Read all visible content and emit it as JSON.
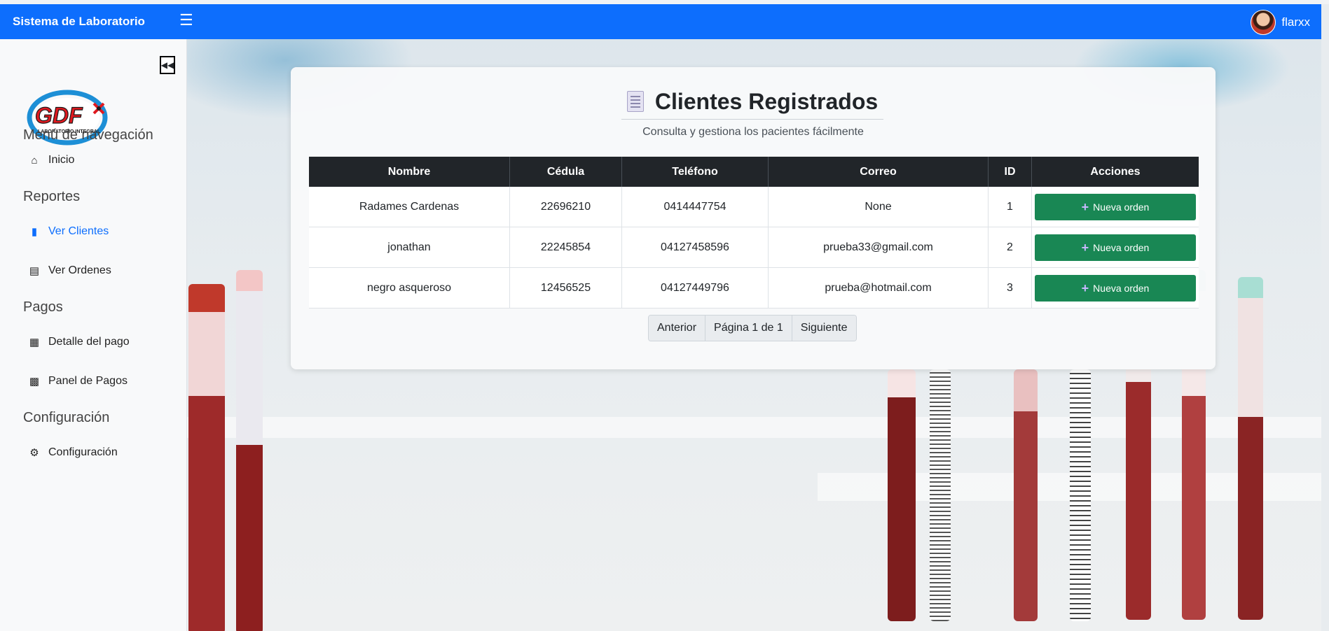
{
  "navbar": {
    "brand": "Sistema de Laboratorio",
    "menu_icon": "hamburger-icon",
    "user_name": "flarxx"
  },
  "sidebar": {
    "logo_text": "GDF",
    "logo_sub": "LABORATORIO INTEGRAL",
    "nav_title": "Menú de navegación",
    "inicio": "Inicio",
    "reportes_title": "Reportes",
    "ver_clientes": "Ver Clientes",
    "ver_ordenes": "Ver Ordenes",
    "pagos_title": "Pagos",
    "detalle_pago": "Detalle del pago",
    "panel_pagos": "Panel de Pagos",
    "config_title": "Configuración",
    "configuracion": "Configuración"
  },
  "main": {
    "title": "Clientes Registrados",
    "subtitle": "Consulta y gestiona los pacientes fácilmente",
    "columns": [
      "Nombre",
      "Cédula",
      "Teléfono",
      "Correo",
      "ID",
      "Acciones"
    ],
    "rows": [
      {
        "nombre": "Radames Cardenas",
        "cedula": "22696210",
        "telefono": "0414447754",
        "correo": "None",
        "id": "1",
        "action": "Nueva orden"
      },
      {
        "nombre": "jonathan",
        "cedula": "22245854",
        "telefono": "04127458596",
        "correo": "prueba33@gmail.com",
        "id": "2",
        "action": "Nueva orden"
      },
      {
        "nombre": "negro asqueroso",
        "cedula": "12456525",
        "telefono": "04127449796",
        "correo": "prueba@hotmail.com",
        "id": "3",
        "action": "Nueva orden"
      }
    ],
    "pagination": {
      "prev": "Anterior",
      "page": "Página 1 de 1",
      "next": "Siguiente"
    }
  },
  "colors": {
    "primary": "#0d6efd",
    "success": "#198754",
    "header_dark": "#212529"
  }
}
